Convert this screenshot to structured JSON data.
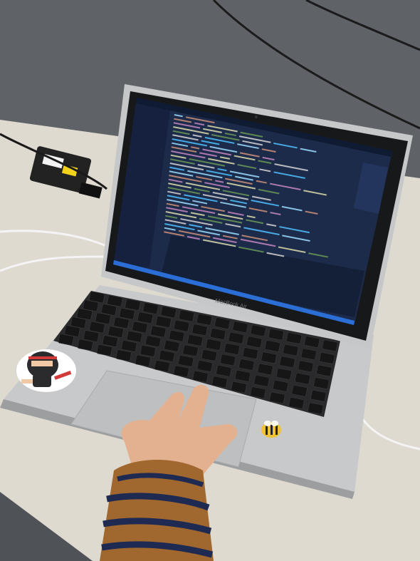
{
  "laptop": {
    "brand_label": "MacBook Air"
  },
  "colors": {
    "floor": "#5d6165",
    "table": "#ddd9cf",
    "laptop_body": "#c9cbcd",
    "screen_bezel": "#1a1b1d",
    "editor_background": "#1d2b4a",
    "sidebar_background": "#1a2440",
    "status_bar": "#2b6fd6",
    "keyboard_keys": "#1c1c1e",
    "sleeve_brown": "#a0682e",
    "sleeve_navy": "#1f2a52"
  },
  "stickers": [
    {
      "name": "ninja-sticker"
    },
    {
      "name": "bee-sticker"
    }
  ]
}
